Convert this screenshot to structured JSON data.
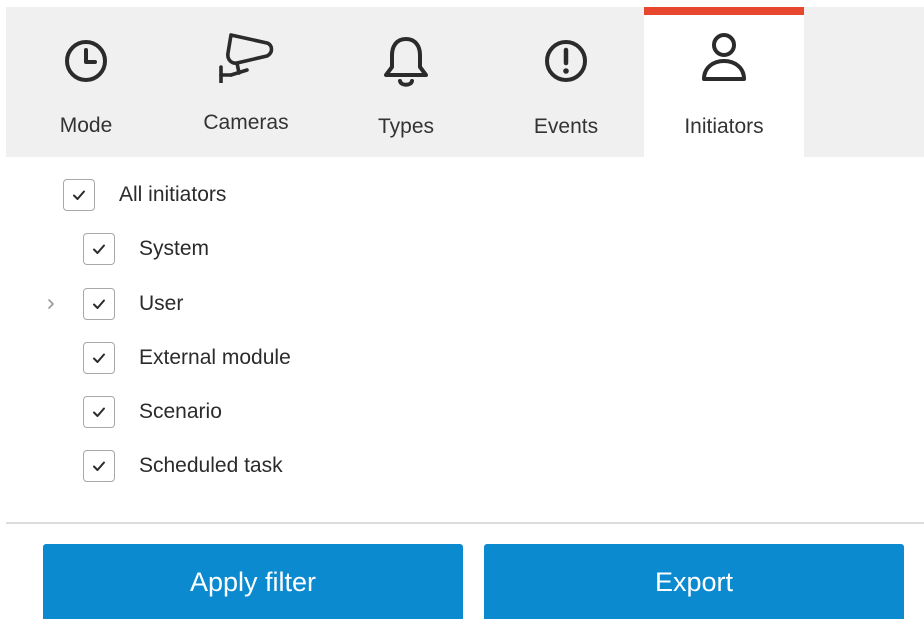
{
  "tabs": [
    {
      "label": "Mode",
      "icon": "clock-icon"
    },
    {
      "label": "Cameras",
      "icon": "camera-icon"
    },
    {
      "label": "Types",
      "icon": "bell-icon"
    },
    {
      "label": "Events",
      "icon": "alert-icon"
    },
    {
      "label": "Initiators",
      "icon": "user-icon",
      "active": true
    }
  ],
  "tree": {
    "all": {
      "label": "All initiators",
      "checked": true
    },
    "items": [
      {
        "label": "System",
        "checked": true
      },
      {
        "label": "User",
        "checked": true,
        "expandable": true
      },
      {
        "label": "External module",
        "checked": true
      },
      {
        "label": "Scenario",
        "checked": true
      },
      {
        "label": "Scheduled task",
        "checked": true
      }
    ]
  },
  "buttons": {
    "apply_label": "Apply filter",
    "export_label": "Export"
  },
  "colors": {
    "accent": "#e8472f",
    "button": "#0b8ad0",
    "tabbar_bg": "#f0f0f0"
  }
}
